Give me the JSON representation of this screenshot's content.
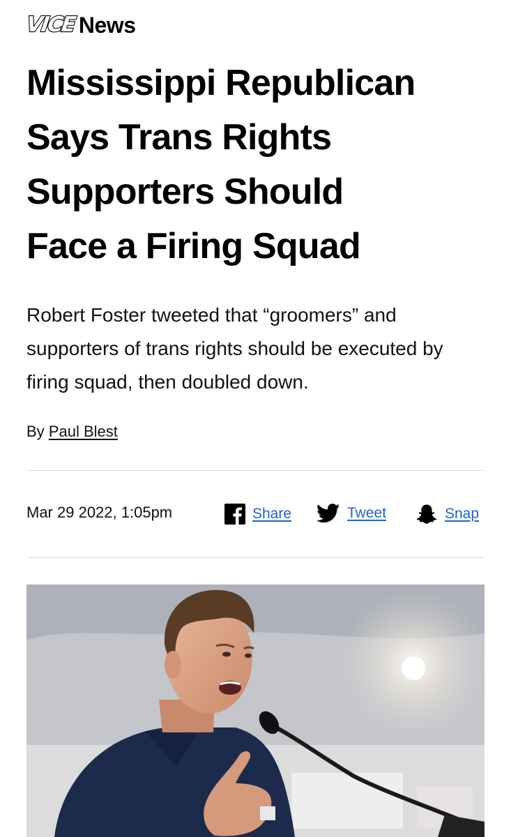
{
  "brand": {
    "logo": "VICE",
    "section": "News"
  },
  "article": {
    "headline_lines": [
      "Mississippi Republican",
      "Says Trans Rights",
      "Supporters Should",
      "Face a Firing Squad"
    ],
    "dek_lines": [
      "Robert Foster tweeted that “groomers” and",
      "supporters of trans rights should be executed by",
      "firing squad, then doubled down."
    ],
    "byline_prefix": "By",
    "author": "Paul Blest",
    "date": "Mar 29 2022, 1:05pm"
  },
  "share": {
    "facebook": {
      "label": "Share",
      "icon": "facebook-icon"
    },
    "twitter": {
      "label": "Tweet",
      "icon": "twitter-bird-icon"
    },
    "snapchat": {
      "label": "Snap",
      "icon": "snapchat-ghost-icon"
    },
    "link_color": "#1d64c8"
  },
  "photo": {
    "subject": "man in navy polo speaking at microphone"
  }
}
